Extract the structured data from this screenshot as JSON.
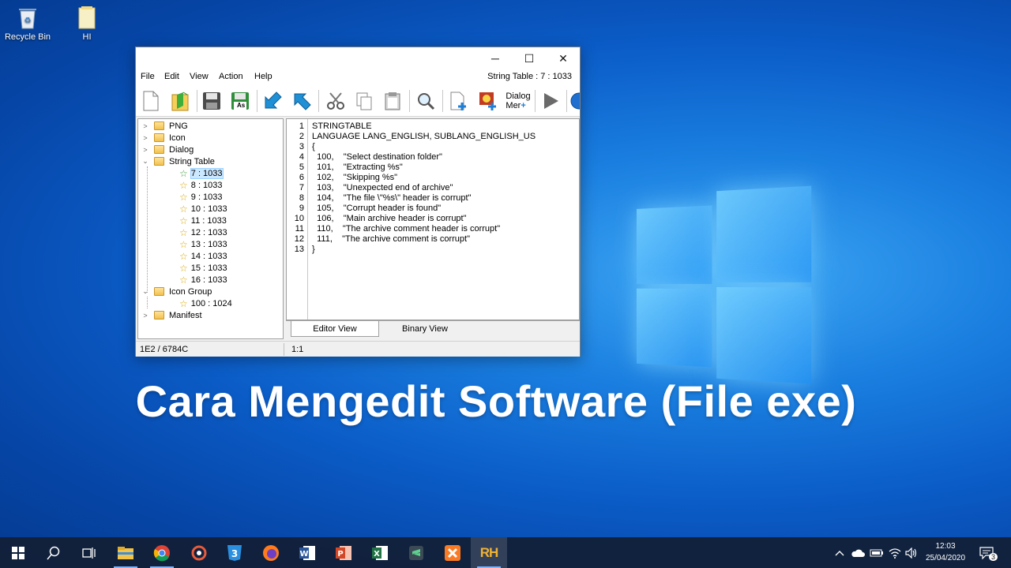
{
  "desktop": {
    "icons": [
      {
        "label": "Recycle Bin",
        "icon": "recycle-bin-icon"
      },
      {
        "label": "HI",
        "icon": "folder-icon"
      }
    ],
    "caption": "Cara Mengedit Software (File exe)"
  },
  "window": {
    "controls": {
      "minimize": "─",
      "maximize": "☐",
      "close": "✕"
    },
    "menu": [
      "File",
      "Edit",
      "View",
      "Action",
      "Help"
    ],
    "status_title": "String Table : 7 : 1033",
    "toolbar": {
      "buttons": [
        {
          "icon": "new-file-icon"
        },
        {
          "icon": "open-icon"
        },
        {
          "icon": "save-icon"
        },
        {
          "icon": "save-as-icon",
          "label": "As"
        },
        {
          "icon": "import-icon"
        },
        {
          "icon": "export-icon"
        },
        {
          "icon": "cut-icon"
        },
        {
          "icon": "copy-icon"
        },
        {
          "icon": "paste-icon"
        },
        {
          "icon": "find-icon"
        },
        {
          "icon": "add-resource-icon"
        },
        {
          "icon": "replace-image-icon"
        },
        {
          "icon": "dialog-menu-icon",
          "label_top": "Dialog",
          "label_bottom": "Mer"
        },
        {
          "icon": "run-icon"
        },
        {
          "icon": "globe-icon"
        }
      ]
    },
    "tree": [
      {
        "label": "PNG",
        "type": "folder",
        "expanded": false,
        "level": 0
      },
      {
        "label": "Icon",
        "type": "folder",
        "expanded": false,
        "level": 0
      },
      {
        "label": "Dialog",
        "type": "folder",
        "expanded": false,
        "level": 0
      },
      {
        "label": "String Table",
        "type": "folder",
        "expanded": true,
        "level": 0
      },
      {
        "label": "7 : 1033",
        "type": "item",
        "level": 1,
        "selected": true
      },
      {
        "label": "8 : 1033",
        "type": "item",
        "level": 1
      },
      {
        "label": "9 : 1033",
        "type": "item",
        "level": 1
      },
      {
        "label": "10 : 1033",
        "type": "item",
        "level": 1
      },
      {
        "label": "11 : 1033",
        "type": "item",
        "level": 1
      },
      {
        "label": "12 : 1033",
        "type": "item",
        "level": 1
      },
      {
        "label": "13 : 1033",
        "type": "item",
        "level": 1
      },
      {
        "label": "14 : 1033",
        "type": "item",
        "level": 1
      },
      {
        "label": "15 : 1033",
        "type": "item",
        "level": 1
      },
      {
        "label": "16 : 1033",
        "type": "item",
        "level": 1
      },
      {
        "label": "Icon Group",
        "type": "folder",
        "expanded": true,
        "level": 0
      },
      {
        "label": "100 : 1024",
        "type": "item",
        "level": 1
      },
      {
        "label": "Manifest",
        "type": "folder",
        "expanded": false,
        "level": 0
      }
    ],
    "editor": {
      "lines": [
        "STRINGTABLE",
        "LANGUAGE LANG_ENGLISH, SUBLANG_ENGLISH_US",
        "{",
        "  100,    \"Select destination folder\"",
        "  101,    \"Extracting %s\"",
        "  102,    \"Skipping %s\"",
        "  103,    \"Unexpected end of archive\"",
        "  104,    \"The file \\\"%s\\\" header is corrupt\"",
        "  105,    \"Corrupt header is found\"",
        "  106,    \"Main archive header is corrupt\"",
        "  110,    \"The archive comment header is corrupt\"",
        "  111,    \"The archive comment is corrupt\"",
        "}"
      ]
    },
    "tabs": [
      {
        "label": "Editor View",
        "active": true
      },
      {
        "label": "Binary View",
        "active": false
      }
    ],
    "statusbar": {
      "left": "1E2 / 6784C",
      "right": "1:1"
    }
  },
  "taskbar": {
    "apps": [
      {
        "icon": "start-icon"
      },
      {
        "icon": "search-icon"
      },
      {
        "icon": "task-view-icon"
      },
      {
        "icon": "file-explorer-icon",
        "running": true
      },
      {
        "icon": "chrome-icon",
        "running": true
      },
      {
        "icon": "app-circle-icon"
      },
      {
        "icon": "css3-icon"
      },
      {
        "icon": "firefox-icon"
      },
      {
        "icon": "word-icon"
      },
      {
        "icon": "powerpoint-icon"
      },
      {
        "icon": "excel-icon"
      },
      {
        "icon": "sublime-icon"
      },
      {
        "icon": "xampp-icon"
      },
      {
        "icon": "resource-hacker-icon",
        "running": true,
        "active": true,
        "label": "RH"
      }
    ],
    "tray": {
      "icons": [
        "chevron-up-icon",
        "onedrive-icon",
        "battery-icon",
        "wifi-icon",
        "volume-icon"
      ],
      "time": "12:03",
      "date": "25/04/2020",
      "notification_count": "3"
    }
  }
}
